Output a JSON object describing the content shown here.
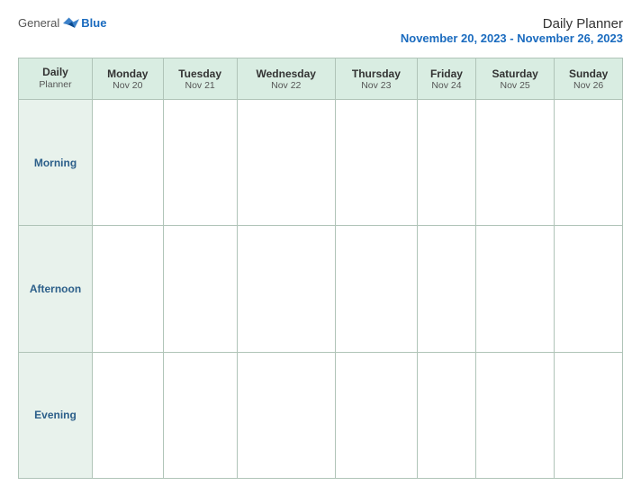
{
  "header": {
    "logo_general": "General",
    "logo_blue": "Blue",
    "title": "Daily Planner",
    "date_range": "November 20, 2023 - November 26, 2023"
  },
  "table": {
    "first_col_header_line1": "Daily",
    "first_col_header_line2": "Planner",
    "columns": [
      {
        "day": "Monday",
        "date": "Nov 20"
      },
      {
        "day": "Tuesday",
        "date": "Nov 21"
      },
      {
        "day": "Wednesday",
        "date": "Nov 22"
      },
      {
        "day": "Thursday",
        "date": "Nov 23"
      },
      {
        "day": "Friday",
        "date": "Nov 24"
      },
      {
        "day": "Saturday",
        "date": "Nov 25"
      },
      {
        "day": "Sunday",
        "date": "Nov 26"
      }
    ],
    "rows": [
      {
        "label": "Morning"
      },
      {
        "label": "Afternoon"
      },
      {
        "label": "Evening"
      }
    ]
  }
}
